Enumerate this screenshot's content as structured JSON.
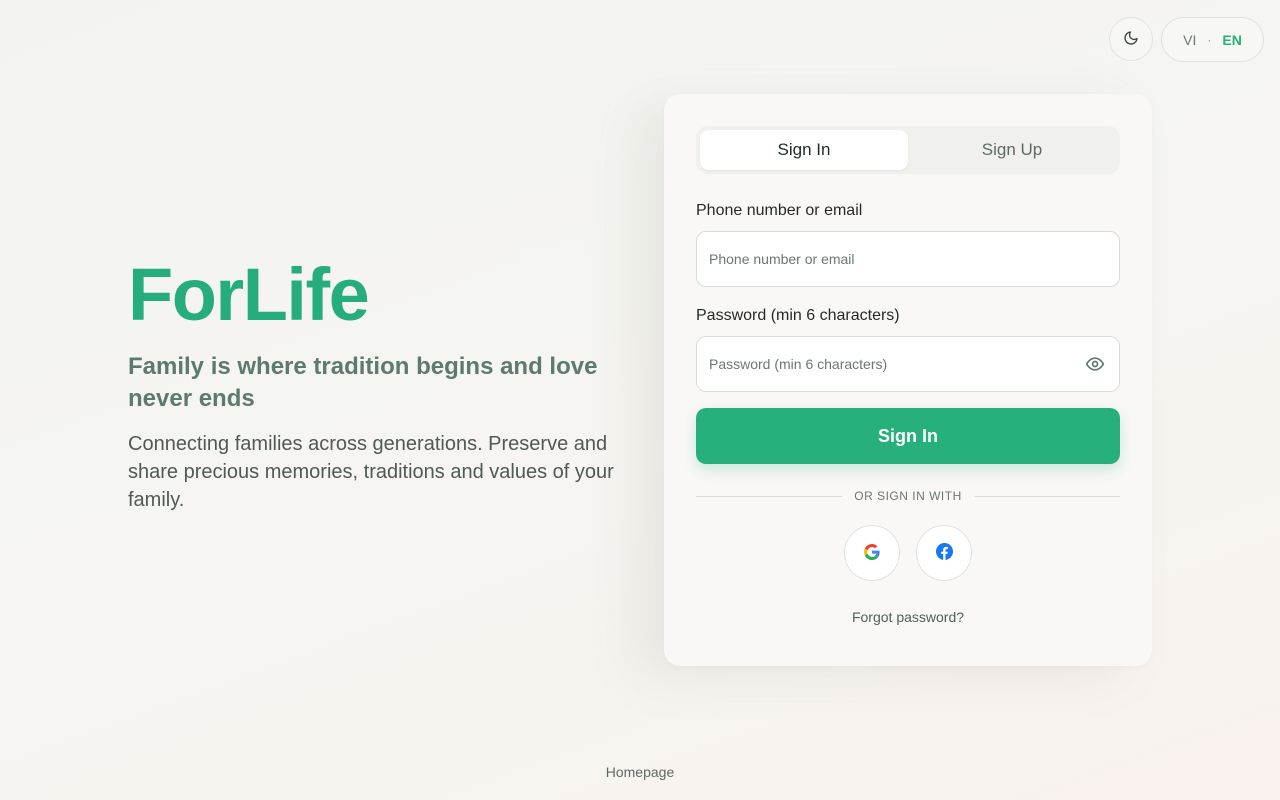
{
  "header": {
    "theme_icon": "moon-icon",
    "lang_vi": "VI",
    "lang_sep": "·",
    "lang_en": "EN",
    "active_lang_color": "#27ae7a"
  },
  "hero": {
    "brand": "ForLife",
    "tagline": "Family is where tradition begins and love never ends",
    "description": "Connecting families across generations. Preserve and share precious memories, traditions and values of your family."
  },
  "auth": {
    "tabs": [
      {
        "label": "Sign In",
        "active": true
      },
      {
        "label": "Sign Up",
        "active": false
      }
    ],
    "identifier_label": "Phone number or email",
    "identifier_placeholder": "Phone number or email",
    "identifier_value": "",
    "password_label": "Password (min 6 characters)",
    "password_placeholder": "Password (min 6 characters)",
    "password_value": "",
    "password_toggle_icon": "eye-icon",
    "submit_label": "Sign In",
    "divider_text": "OR SIGN IN WITH",
    "social": [
      {
        "provider": "Google",
        "icon": "google-icon"
      },
      {
        "provider": "Facebook",
        "icon": "facebook-icon"
      }
    ],
    "forgot_label": "Forgot password?"
  },
  "footer": {
    "homepage_label": "Homepage"
  },
  "colors": {
    "brand": "#25ae7b",
    "button": "#27b07c",
    "tagline": "#5d7a70"
  }
}
